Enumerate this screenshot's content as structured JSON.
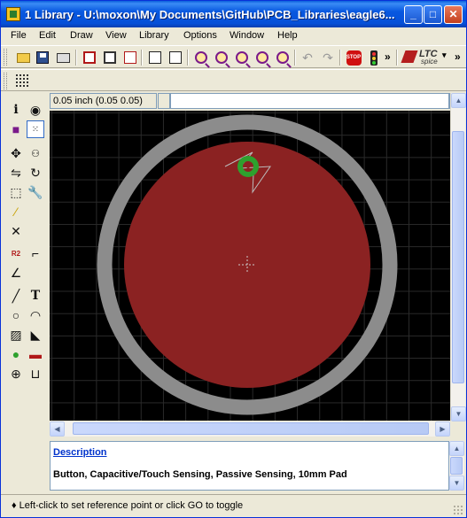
{
  "window": {
    "title": "1 Library - U:\\moxon\\My Documents\\GitHub\\PCB_Libraries\\eagle6...",
    "min": "_",
    "max": "□",
    "close": "✕"
  },
  "menu": [
    "File",
    "Edit",
    "Draw",
    "View",
    "Library",
    "Options",
    "Window",
    "Help"
  ],
  "toolbar": {
    "icons": [
      "open-icon",
      "save-icon",
      "print-icon",
      "cam-icon",
      "board-icon",
      "schematic-icon",
      "script-icon",
      "ulp-icon",
      "zoom-fit-icon",
      "zoom-in-icon",
      "zoom-out-icon",
      "zoom-redraw-icon",
      "zoom-select-icon",
      "undo-icon",
      "redo-icon",
      "stop-icon",
      "go-icon"
    ],
    "stop_label": "STOP",
    "ltc_title": "LTC",
    "ltc_sub": "spice",
    "chevron": "»"
  },
  "coords": {
    "value": "0.05 inch (0.05 0.05)"
  },
  "command": {
    "value": ""
  },
  "description": {
    "link": "Description",
    "text": "Button, Capacitive/Touch Sensing, Passive Sensing, 10mm Pad"
  },
  "status": {
    "text": "♦ Left-click to set reference point or click GO to toggle"
  },
  "colors": {
    "pad": "#8b2222",
    "ring": "#8c8c8c",
    "via": "#2ea12e",
    "background": "#000000",
    "grid": "#2a2a2a"
  }
}
